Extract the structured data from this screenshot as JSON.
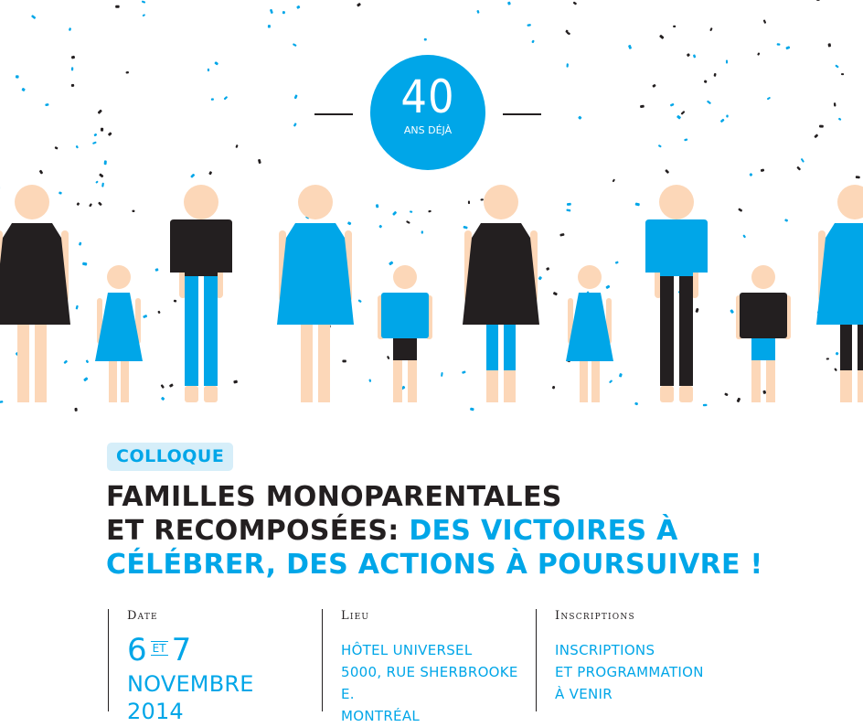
{
  "badge": {
    "number": "40",
    "subtitle": "ANS DÉJÀ"
  },
  "tag": "COLLOQUE",
  "title": {
    "line1": "FAMILLES MONOPARENTALES",
    "line2_dark": "ET RECOMPOSÉES:",
    "line2_blue": "DES VICTOIRES À",
    "line3": "CÉLÉBRER, DES ACTIONS À POURSUIVRE !"
  },
  "info": {
    "date": {
      "heading": "Date",
      "day1": "6",
      "et": "ET",
      "day2": "7",
      "month": "NOVEMBRE 2014"
    },
    "lieu": {
      "heading": "Lieu",
      "line1": "HÔTEL UNIVERSEL",
      "line2": "5000, RUE SHERBROOKE E.",
      "line3": "MONTRÉAL"
    },
    "inscriptions": {
      "heading": "Inscriptions",
      "line1": "INSCRIPTIONS",
      "line2": "ET PROGRAMMATION",
      "line3": "À VENIR"
    }
  },
  "colors": {
    "blue": "#00a6e8",
    "dark": "#231f20",
    "skin": "#fcd7b8",
    "tag_bg": "#d6eef9"
  },
  "figures": [
    {
      "kind": "woman",
      "top": "dark",
      "legs": "skin"
    },
    {
      "kind": "girl",
      "top": "blue",
      "legs": "skin"
    },
    {
      "kind": "man",
      "top": "dark",
      "legs": "blue"
    },
    {
      "kind": "woman",
      "top": "blue",
      "legs": "skin"
    },
    {
      "kind": "boy",
      "top": "blue",
      "legs": "dark"
    },
    {
      "kind": "woman",
      "top": "dark",
      "legs": "blue"
    },
    {
      "kind": "girl",
      "top": "blue",
      "legs": "skin"
    },
    {
      "kind": "man",
      "top": "blue",
      "legs": "dark"
    },
    {
      "kind": "boy",
      "top": "dark",
      "legs": "blue"
    },
    {
      "kind": "woman",
      "top": "blue",
      "legs": "dark"
    }
  ]
}
